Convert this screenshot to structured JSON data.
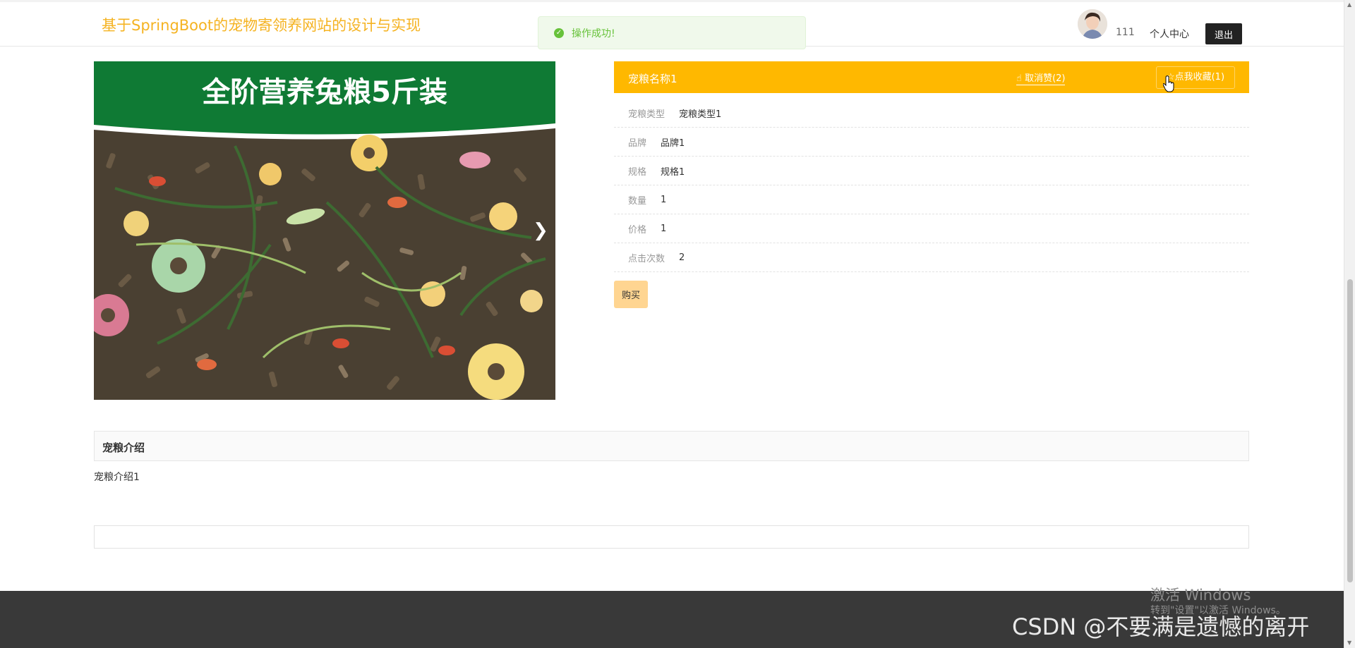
{
  "header": {
    "site_title": "基于SpringBoot的宠物寄领养网站的设计与实现",
    "username": "111",
    "center_link": "个人中心",
    "logout_label": "退出"
  },
  "toast": {
    "message": "操作成功!",
    "icon": "check-circle-icon",
    "color": "#67c23a"
  },
  "carousel": {
    "banner_line1": "全阶营养兔粮5斤装",
    "next_icon": "chevron-right-icon"
  },
  "detail": {
    "name": "宠粮名称1",
    "like_label": "取消赞(2)",
    "favorite_label": "点我收藏(1)",
    "header_color": "#ffb800",
    "rows": [
      {
        "label": "宠粮类型",
        "value": "宠粮类型1"
      },
      {
        "label": "品牌",
        "value": "品牌1"
      },
      {
        "label": "规格",
        "value": "规格1"
      },
      {
        "label": "数量",
        "value": "1"
      },
      {
        "label": "价格",
        "value": "1"
      },
      {
        "label": "点击次数",
        "value": "2"
      }
    ],
    "buy_label": "购买"
  },
  "intro": {
    "title": "宠粮介绍",
    "text": "宠粮介绍1"
  },
  "overlay": {
    "windows_line1": "激活 Windows",
    "windows_line2": "转到\"设置\"以激活 Windows。",
    "csdn_watermark": "CSDN @不要满是遗憾的离开"
  }
}
